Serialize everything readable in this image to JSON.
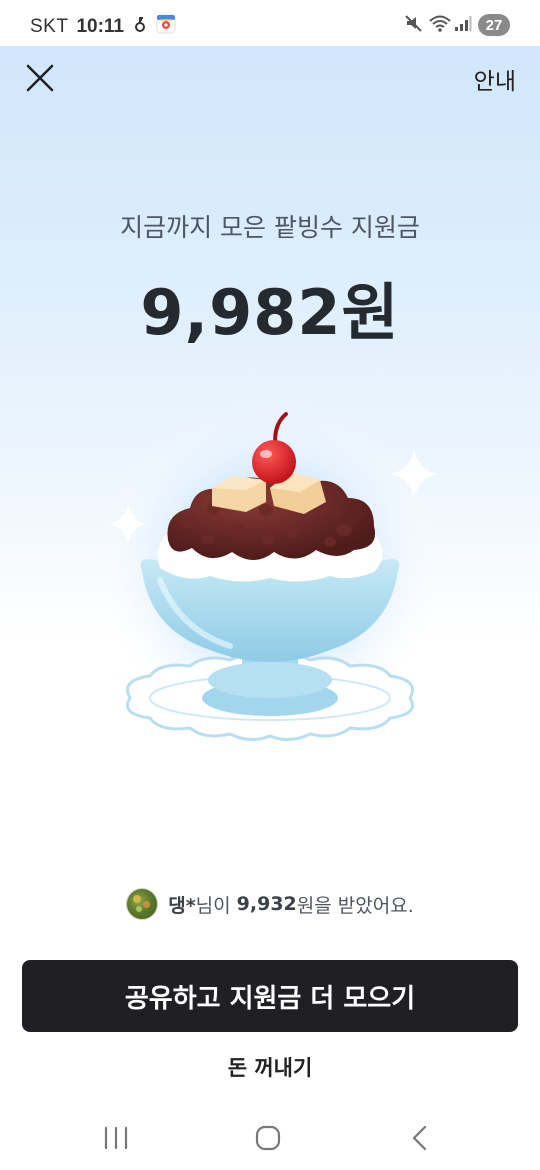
{
  "status_bar": {
    "carrier": "SKT",
    "time": "10:11",
    "battery": "27",
    "icons": [
      "key-icon",
      "location-app-icon",
      "mute-icon",
      "wifi-icon",
      "signal-icon"
    ]
  },
  "header": {
    "close_icon": "close-icon",
    "guide_label": "안내"
  },
  "main": {
    "headline": "지금까지 모은 팥빙수 지원금",
    "amount": "9,982원",
    "illustration": "patbingsu-icon"
  },
  "notice": {
    "user": "댕*",
    "text_1": "님이 ",
    "amount": "9,932",
    "text_2": "원을 받았어요."
  },
  "actions": {
    "share_button_label": "공유하고 지원금 더 모으기",
    "withdraw_label": "돈 꺼내기"
  },
  "nav": {
    "icons": [
      "recent-apps-icon",
      "home-icon",
      "back-icon"
    ]
  },
  "colors": {
    "button_bg": "#202024",
    "gradient_top": "#cfe5fb",
    "text_main": "#252a31"
  }
}
